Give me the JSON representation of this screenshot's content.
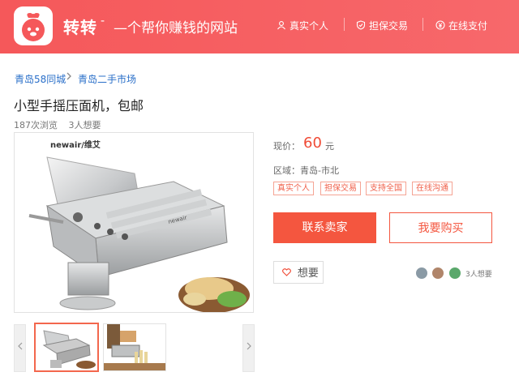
{
  "header": {
    "brand": "转转",
    "slogan": "—个帮你赚钱的网站",
    "features": [
      {
        "label": "真实个人",
        "icon": "person-icon"
      },
      {
        "label": "担保交易",
        "icon": "shield-icon"
      },
      {
        "label": "在线支付",
        "icon": "yen-icon"
      }
    ]
  },
  "breadcrumb": [
    "青岛58同城",
    "青岛二手市场"
  ],
  "product": {
    "title": "小型手摇压面机，包邮",
    "views": "187次浏览",
    "wants": "3人想要",
    "image_brand": "newair/维艾",
    "machine_label": "newair"
  },
  "info": {
    "price_label": "现价：",
    "price": "60",
    "price_unit": "元",
    "area": "区域：青岛-市北",
    "tags": [
      "真实个人",
      "担保交易",
      "支持全国",
      "在线沟通"
    ]
  },
  "actions": {
    "contact": "联系卖家",
    "buy": "我要购买",
    "want": "想要",
    "want_count": "3人想要"
  },
  "colors": {
    "header": "#f5585a",
    "accent": "#f4563f",
    "link": "#2a6fc9"
  }
}
